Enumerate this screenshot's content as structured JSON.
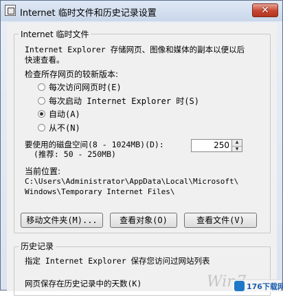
{
  "window": {
    "title": "Internet 临时文件和历史记录设置",
    "close_label": "✕"
  },
  "temp_files": {
    "group_title": "Internet 临时文件",
    "description_line1": "Internet Explorer 存储网页、图像和媒体的副本以便以后",
    "description_line2": "快速查看。",
    "check_prompt": "检查所存网页的较新版本:",
    "options": [
      {
        "label": "每次访问网页时(E)",
        "selected": false
      },
      {
        "label": "每次启动 Internet Explorer 时(S)",
        "selected": false
      },
      {
        "label": "自动(A)",
        "selected": true
      },
      {
        "label": "从不(N)",
        "selected": false
      }
    ],
    "disk_space_label": "要使用的磁盘空间(8 - 1024MB)(D):",
    "disk_space_hint": "(推荐: 50 - 250MB)",
    "disk_space_value": "250",
    "location_label": "当前位置:",
    "location_line1": "C:\\Users\\Administrator\\AppData\\Local\\Microsoft\\",
    "location_line2": "Windows\\Temporary Internet Files\\",
    "buttons": {
      "move_folder": "移动文件夹(M)...",
      "view_objects": "查看对象(O)",
      "view_files": "查看文件(V)"
    }
  },
  "history": {
    "group_title": "历史记录",
    "description": "指定 Internet Explorer 保存您访问过网站列表",
    "days_label": "网页保存在历史记录中的天数(K)"
  },
  "watermarks": {
    "win_text": "Win7",
    "logo_text": "176下载网"
  }
}
